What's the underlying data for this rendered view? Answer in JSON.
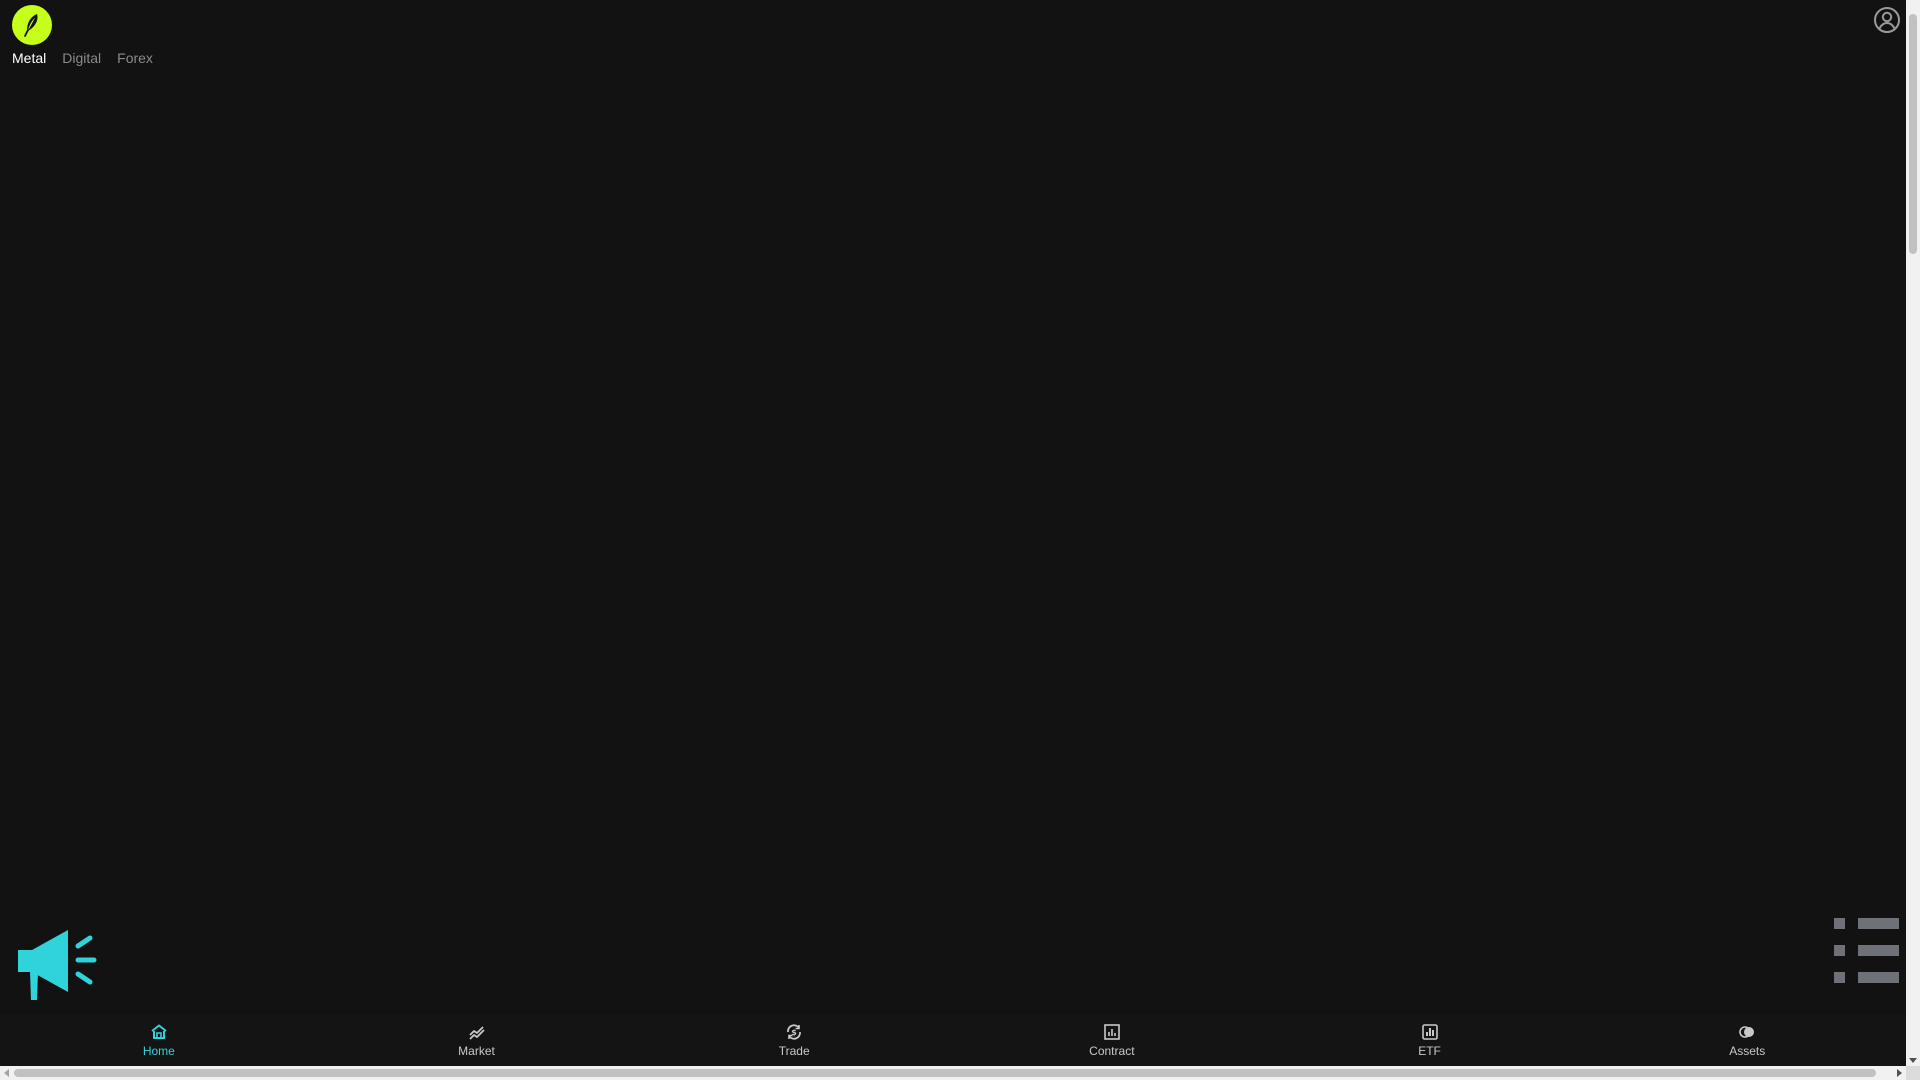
{
  "header": {
    "logo_icon": "feather-logo-icon",
    "user_icon": "user-circle-icon",
    "market_tabs": [
      {
        "label": "Metal",
        "active": true
      },
      {
        "label": "Digital",
        "active": false
      },
      {
        "label": "Forex",
        "active": false
      }
    ]
  },
  "announcement": {
    "icon": "megaphone-icon"
  },
  "bottom_nav": {
    "items": [
      {
        "label": "Home",
        "icon": "home-icon",
        "active": true
      },
      {
        "label": "Market",
        "icon": "chart-line-icon",
        "active": false
      },
      {
        "label": "Trade",
        "icon": "trade-coin-icon",
        "active": false
      },
      {
        "label": "Contract",
        "icon": "contract-chart-icon",
        "active": false
      },
      {
        "label": "ETF",
        "icon": "bar-chart-icon",
        "active": false
      },
      {
        "label": "Assets",
        "icon": "assets-coins-icon",
        "active": false
      }
    ]
  },
  "colors": {
    "background": "#121212",
    "accent": "#2fd3d9",
    "logo": "#c6ff1a",
    "tab_inactive": "#8a8a8a",
    "tab_active": "#ffffff"
  }
}
